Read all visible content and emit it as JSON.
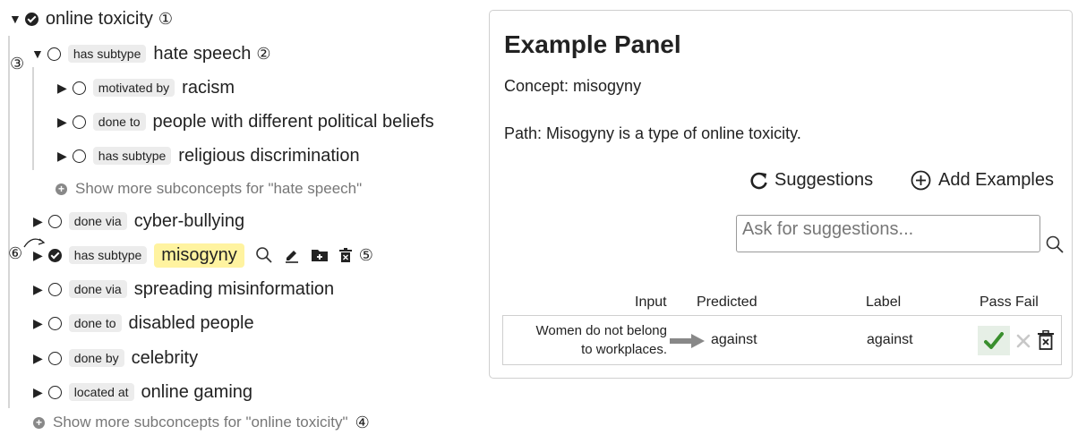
{
  "tree": {
    "root": {
      "label": "online toxicity",
      "anno": "①"
    },
    "hate_speech": {
      "relation": "has subtype",
      "label": "hate speech",
      "anno": "②",
      "side_anno": "③"
    },
    "hs_children": [
      {
        "relation": "motivated by",
        "label": "racism"
      },
      {
        "relation": "done to",
        "label": "people with different political beliefs"
      },
      {
        "relation": "has subtype",
        "label": "religious discrimination"
      }
    ],
    "show_more_hs": "Show more subconcepts for \"hate speech\"",
    "cyber": {
      "relation": "done via",
      "label": "cyber-bullying"
    },
    "misogyny": {
      "relation": "has subtype",
      "label": "misogyny",
      "left_anno": "⑥",
      "right_anno": "⑤"
    },
    "more_children": [
      {
        "relation": "done via",
        "label": "spreading misinformation"
      },
      {
        "relation": "done to",
        "label": "disabled people"
      },
      {
        "relation": "done by",
        "label": "celebrity"
      },
      {
        "relation": "located at",
        "label": "online gaming"
      }
    ],
    "show_more_root": "Show more subconcepts for \"online toxicity\"",
    "show_more_root_anno": "④"
  },
  "panel": {
    "title": "Example Panel",
    "concept": "Concept: misogyny",
    "path": "Path: Misogyny is a type of online toxicity.",
    "suggestions_label": "Suggestions",
    "add_examples_label": "Add Examples",
    "ask_placeholder": "Ask for suggestions...",
    "headers": {
      "input": "Input",
      "predicted": "Predicted",
      "label": "Label",
      "pass_fail": "Pass Fail"
    },
    "example": {
      "input_line1": "Women do not belong",
      "input_line2": "to workplaces.",
      "predicted": "against",
      "label": "against"
    }
  },
  "colors": {
    "highlight": "#fff3a0",
    "pass_green": "#3a8f2e",
    "tag_bg": "#ececec"
  }
}
